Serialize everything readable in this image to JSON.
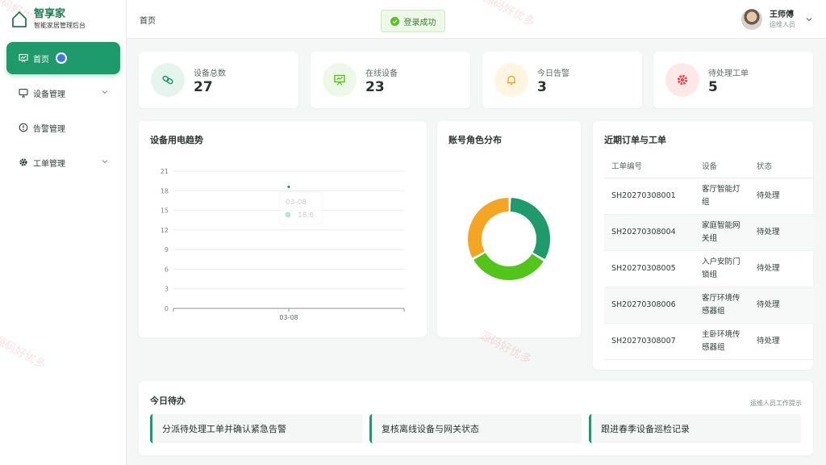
{
  "brand": {
    "title": "智享家",
    "subtitle": "智能家居管理后台"
  },
  "sidebar": {
    "items": [
      {
        "label": "首页",
        "icon": "monitor-chart-icon",
        "active": true
      },
      {
        "label": "设备管理",
        "icon": "monitor-icon",
        "has_children": true
      },
      {
        "label": "告警管理",
        "icon": "alert-circle-icon"
      },
      {
        "label": "工单管理",
        "icon": "gear-icon",
        "has_children": true
      }
    ]
  },
  "header": {
    "breadcrumb": "首页",
    "toast": "登录成功",
    "user": {
      "name": "王师傅",
      "role": "运维人员"
    }
  },
  "stats": [
    {
      "label": "设备总数",
      "value": "27",
      "icon": "link-icon",
      "color": "#1f9a6c"
    },
    {
      "label": "在线设备",
      "value": "23",
      "icon": "presentation-icon",
      "color": "#52c41a"
    },
    {
      "label": "今日告警",
      "value": "3",
      "icon": "bell-icon",
      "color": "#f5a524"
    },
    {
      "label": "待处理工单",
      "value": "5",
      "icon": "gear-icon",
      "color": "#e84c4c"
    }
  ],
  "power_chart": {
    "title": "设备用电趋势",
    "tooltip": {
      "date": "03-08",
      "value": "18.6"
    }
  },
  "role_chart": {
    "title": "账号角色分布"
  },
  "orders": {
    "title": "近期订单与工单",
    "columns": [
      "工单编号",
      "设备",
      "状态"
    ],
    "rows": [
      {
        "id": "SH20270308001",
        "device_l1": "客厅智能灯",
        "device_l2": "组",
        "status": "待处理"
      },
      {
        "id": "SH20270308004",
        "device_l1": "家庭智能网",
        "device_l2": "关组",
        "status": "待处理"
      },
      {
        "id": "SH20270308005",
        "device_l1": "入户安防门",
        "device_l2": "锁组",
        "status": "待处理"
      },
      {
        "id": "SH20270308006",
        "device_l1": "客厅环境传",
        "device_l2": "感器组",
        "status": "待处理"
      },
      {
        "id": "SH20270308007",
        "device_l1": "主卧环境传",
        "device_l2": "感器组",
        "status": "待处理"
      }
    ]
  },
  "todo": {
    "title": "今日待办",
    "note": "运维人员工作提示",
    "items": [
      "分派待处理工单并确认紧急告警",
      "复核离线设备与网关状态",
      "跟进春季设备巡检记录"
    ]
  },
  "watermark": "源码好优多",
  "chart_data": [
    {
      "type": "line",
      "title": "设备用电趋势",
      "categories": [
        "03-08"
      ],
      "series": [
        {
          "values": [
            18.6
          ]
        }
      ],
      "yticks": [
        "0",
        "3",
        "6",
        "9",
        "12",
        "15",
        "18",
        "21"
      ],
      "ylim": [
        0,
        21
      ],
      "grid": true
    },
    {
      "type": "pie",
      "title": "账号角色分布",
      "slices": [
        {
          "value": 1,
          "color": "#1f9a6c"
        },
        {
          "value": 1,
          "color": "#52c41a"
        },
        {
          "value": 1,
          "color": "#f5a524"
        }
      ]
    }
  ]
}
